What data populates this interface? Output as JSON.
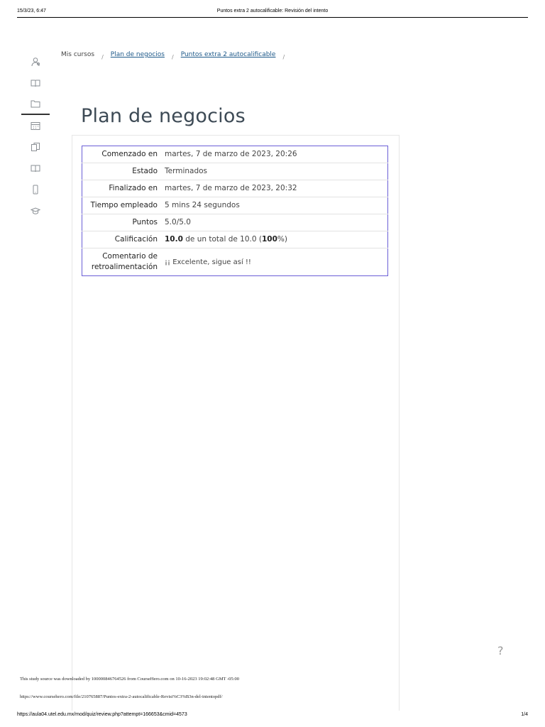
{
  "print_header": {
    "date": "15/3/23, 6:47",
    "title": "Puntos extra 2 autocalificable: Revisión del intento"
  },
  "sidebar": {
    "icons": [
      "user-icon",
      "book-icon",
      "folder-icon",
      "calendar-icon",
      "copy-icon",
      "book-icon",
      "phone-icon",
      "graduation-cap-icon"
    ],
    "active_index": 2
  },
  "breadcrumb": {
    "items": [
      "Mis cursos",
      "Plan de negocios",
      "Puntos extra 2 autocalificable"
    ],
    "separator": "/"
  },
  "page_title": "Plan de negocios",
  "summary": {
    "started_label": "Comenzado en",
    "started_value": "martes, 7 de marzo de 2023, 20:26",
    "state_label": "Estado",
    "state_value": "Terminados",
    "finished_label": "Finalizado en",
    "finished_value": "martes, 7 de marzo de 2023, 20:32",
    "time_label": "Tiempo empleado",
    "time_value": "5 mins 24 segundos",
    "points_label": "Puntos",
    "points_value": "5.0/5.0",
    "grade_label": "Calificación",
    "grade_value": "10.0",
    "grade_text_mid": " de un total de 10.0 (",
    "grade_percent": "100",
    "grade_text_end": "%)",
    "feedback_label": "Comentario de retroalimentación",
    "feedback_value": "¡¡ Excelente, sigue así !!"
  },
  "help_glyph": "?",
  "source_note": "This study source was downloaded by 100000846764526 from CourseHero.com on 10-16-2023 19:02:48 GMT -05:00",
  "source_url": "https://www.coursehero.com/file/210765887/Puntos-extra-2-autocalificable-Revisi%C3%B3n-del-intentopdf/",
  "print_footer": {
    "url": "https://aula04.utel.edu.mx/mod/quiz/review.php?attempt=166653&cmid=4573",
    "page": "1/4"
  }
}
